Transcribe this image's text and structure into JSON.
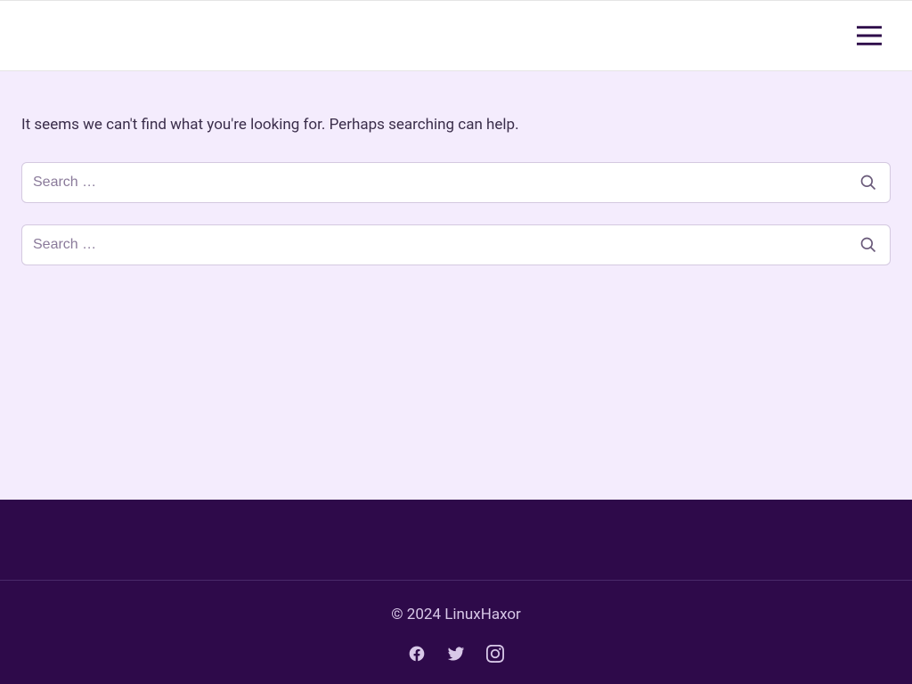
{
  "content": {
    "message": "It seems we can't find what you're looking for. Perhaps searching can help.",
    "search1": {
      "placeholder": "Search …"
    },
    "search2": {
      "placeholder": "Search …"
    }
  },
  "footer": {
    "copyright": "© 2024 LinuxHaxor"
  }
}
